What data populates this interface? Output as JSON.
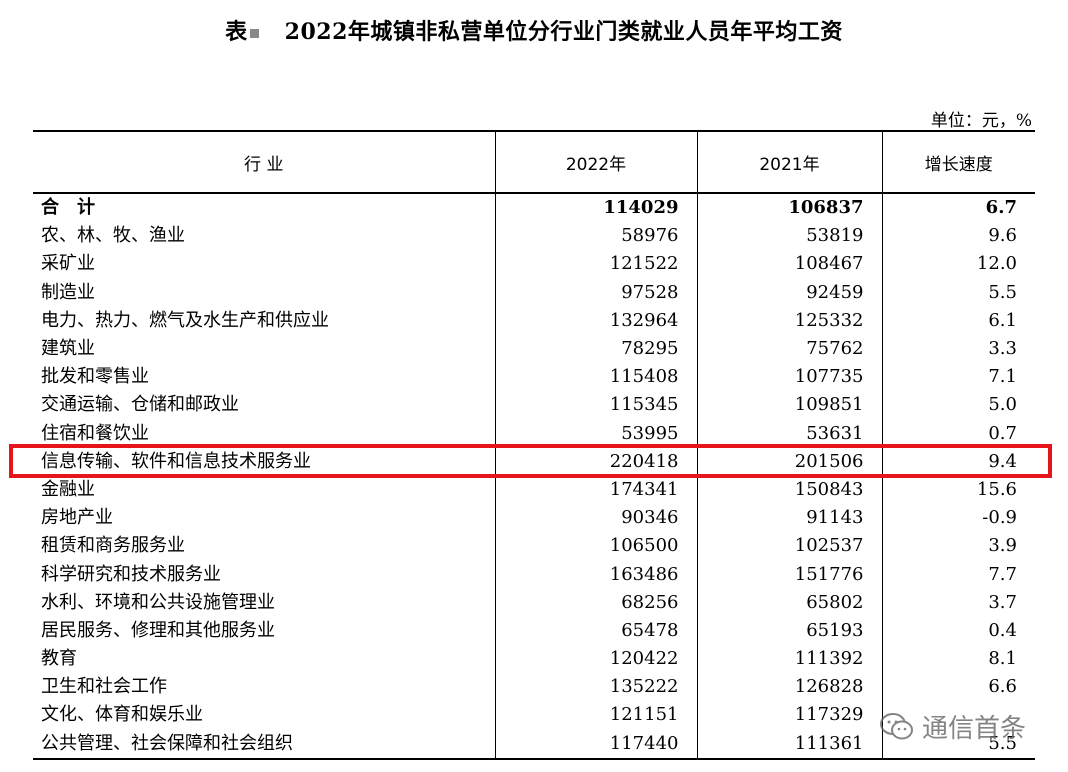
{
  "title": {
    "prefix": "表",
    "text": "2022年城镇非私营单位分行业门类就业人员年平均工资"
  },
  "unit": "单位：元，%",
  "headers": {
    "industry": "行 业",
    "y2022": "2022年",
    "y2021": "2021年",
    "growth": "增长速度"
  },
  "rows": [
    {
      "industry": "合　计",
      "y2022": "114029",
      "y2021": "106837",
      "growth": "6.7"
    },
    {
      "industry": "农、林、牧、渔业",
      "y2022": "58976",
      "y2021": "53819",
      "growth": "9.6"
    },
    {
      "industry": "采矿业",
      "y2022": "121522",
      "y2021": "108467",
      "growth": "12.0"
    },
    {
      "industry": "制造业",
      "y2022": "97528",
      "y2021": "92459",
      "growth": "5.5"
    },
    {
      "industry": "电力、热力、燃气及水生产和供应业",
      "y2022": "132964",
      "y2021": "125332",
      "growth": "6.1"
    },
    {
      "industry": "建筑业",
      "y2022": "78295",
      "y2021": "75762",
      "growth": "3.3"
    },
    {
      "industry": "批发和零售业",
      "y2022": "115408",
      "y2021": "107735",
      "growth": "7.1"
    },
    {
      "industry": "交通运输、仓储和邮政业",
      "y2022": "115345",
      "y2021": "109851",
      "growth": "5.0"
    },
    {
      "industry": "住宿和餐饮业",
      "y2022": "53995",
      "y2021": "53631",
      "growth": "0.7"
    },
    {
      "industry": "信息传输、软件和信息技术服务业",
      "y2022": "220418",
      "y2021": "201506",
      "growth": "9.4"
    },
    {
      "industry": "金融业",
      "y2022": "174341",
      "y2021": "150843",
      "growth": "15.6"
    },
    {
      "industry": "房地产业",
      "y2022": "90346",
      "y2021": "91143",
      "growth": "-0.9"
    },
    {
      "industry": "租赁和商务服务业",
      "y2022": "106500",
      "y2021": "102537",
      "growth": "3.9"
    },
    {
      "industry": "科学研究和技术服务业",
      "y2022": "163486",
      "y2021": "151776",
      "growth": "7.7"
    },
    {
      "industry": "水利、环境和公共设施管理业",
      "y2022": "68256",
      "y2021": "65802",
      "growth": "3.7"
    },
    {
      "industry": "居民服务、修理和其他服务业",
      "y2022": "65478",
      "y2021": "65193",
      "growth": "0.4"
    },
    {
      "industry": "教育",
      "y2022": "120422",
      "y2021": "111392",
      "growth": "8.1"
    },
    {
      "industry": "卫生和社会工作",
      "y2022": "135222",
      "y2021": "126828",
      "growth": "6.6"
    },
    {
      "industry": "文化、体育和娱乐业",
      "y2022": "121151",
      "y2021": "117329",
      "growth": ""
    },
    {
      "industry": "公共管理、社会保障和社会组织",
      "y2022": "117440",
      "y2021": "111361",
      "growth": "5.5"
    }
  ],
  "highlight": {
    "row_index": 9,
    "color": "#e8141c"
  },
  "watermark": {
    "text": "通信首条",
    "icon": "wechat-icon"
  }
}
